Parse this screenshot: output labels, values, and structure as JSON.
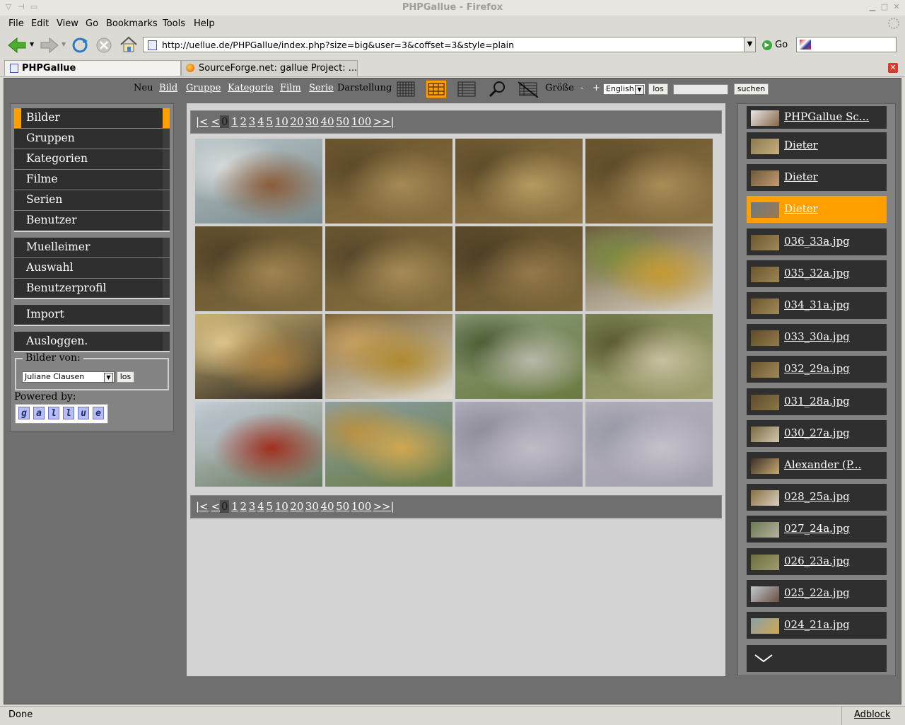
{
  "window": {
    "title": "PHPGallue - Firefox"
  },
  "menubar": [
    "File",
    "Edit",
    "View",
    "Go",
    "Bookmarks",
    "Tools",
    "Help"
  ],
  "address": {
    "url": "http://uellue.de/PHPGallue/index.php?size=big&user=3&coffset=3&style=plain",
    "go_label": "Go"
  },
  "tabs": [
    {
      "label": "PHPGallue",
      "active": true
    },
    {
      "label": "SourceForge.net: gallue Project: ...",
      "active": false
    }
  ],
  "topnav": {
    "neu": "Neu",
    "links": [
      "Bild",
      "Gruppe",
      "Kategorie",
      "Film",
      "Serie"
    ],
    "darstellung": "Darstellung",
    "groesse": "Größe",
    "minus": "-",
    "plus": "+",
    "language": "English",
    "los": "los",
    "search_button": "suchen",
    "active_view": "grid-big"
  },
  "leftmenu": {
    "group1": [
      "Bilder",
      "Gruppen",
      "Kategorien",
      "Filme",
      "Serien",
      "Benutzer"
    ],
    "group2": [
      "Muelleimer",
      "Auswahl",
      "Benutzerprofil"
    ],
    "group3": [
      "Import"
    ],
    "group4": [
      "Ausloggen."
    ],
    "active": "Bilder",
    "bilder_von": {
      "legend": "Bilder von:",
      "selected_user": "Juliane Clausen",
      "los": "los"
    },
    "powered_by": "Powered by:",
    "logo_letters": [
      "g",
      "a",
      "l",
      "l",
      "u",
      "e"
    ]
  },
  "pager": {
    "items": [
      "|<",
      "<",
      "0",
      "1",
      "2",
      "3",
      "4",
      "5",
      "10",
      "20",
      "30",
      "40",
      "50",
      "100",
      ">",
      ">|"
    ],
    "current": "0"
  },
  "thumbnails": [
    {
      "name": "man-at-lake-photo",
      "colors": [
        "#b7c3c6",
        "#7a8a8c",
        "#8a5c3a",
        "#d8dcdc"
      ]
    },
    {
      "name": "stream-bed-photo",
      "colors": [
        "#6a5530",
        "#8a7040",
        "#a58a55",
        "#5a4828"
      ]
    },
    {
      "name": "stream-bed-photo",
      "colors": [
        "#6d5832",
        "#917745",
        "#b59a60",
        "#5c4a29"
      ]
    },
    {
      "name": "stream-bed-photo",
      "colors": [
        "#6a5530",
        "#8c7342",
        "#a98d58",
        "#5b4928"
      ]
    },
    {
      "name": "stream-bed-photo",
      "colors": [
        "#63502e",
        "#7e6a3e",
        "#a08450",
        "#4f4126"
      ]
    },
    {
      "name": "stream-bed-photo",
      "colors": [
        "#6a5532",
        "#85703f",
        "#a68b55",
        "#56462a"
      ]
    },
    {
      "name": "stream-bed-photo",
      "colors": [
        "#5c4a2a",
        "#7c673a",
        "#94794a",
        "#4c3e24"
      ]
    },
    {
      "name": "elderly-woman-photo",
      "colors": [
        "#6a5a3a",
        "#d8d0c0",
        "#c49a30",
        "#7a8a40"
      ]
    },
    {
      "name": "young-man-photo",
      "colors": [
        "#c8b070",
        "#2a2420",
        "#a88040",
        "#e0c890"
      ]
    },
    {
      "name": "elderly-woman-photo",
      "colors": [
        "#7a6030",
        "#e0dcd0",
        "#b08a30",
        "#c8a060"
      ]
    },
    {
      "name": "forest-river-photo",
      "colors": [
        "#8a9a7a",
        "#6a7a40",
        "#b8b8a8",
        "#4a5a30"
      ]
    },
    {
      "name": "reeds-water-photo",
      "colors": [
        "#7a8050",
        "#a0a070",
        "#c8c0a0",
        "#585830"
      ]
    },
    {
      "name": "canoe-lake-photo",
      "colors": [
        "#c8d0d8",
        "#6a7a60",
        "#a03020",
        "#b0bcc4"
      ]
    },
    {
      "name": "marsh-landscape-photo",
      "colors": [
        "#8aa0a8",
        "#6a7a40",
        "#d0a850",
        "#b89040"
      ]
    },
    {
      "name": "birds-sky-photo",
      "colors": [
        "#b0aeba",
        "#9c9aa8",
        "#c0bcc6",
        "#8e8c98"
      ]
    },
    {
      "name": "birds-sky-photo",
      "colors": [
        "#b4b0bc",
        "#a2a0ac",
        "#c6c0ca",
        "#969aa6"
      ]
    }
  ],
  "rightlist": [
    {
      "label": "PHPGallue Sc...",
      "thumb": [
        "#e8e8e8",
        "#886644"
      ]
    },
    {
      "label": "Dieter",
      "thumb": [
        "#8a7a50",
        "#c8b080"
      ]
    },
    {
      "label": "Dieter",
      "thumb": [
        "#6a5a3a",
        "#c89a70"
      ]
    },
    {
      "label": "Dieter",
      "thumb": [
        "#6a7a80",
        "#a07850"
      ],
      "active": true
    },
    {
      "label": "036_33a.jpg",
      "thumb": [
        "#6a5530",
        "#a08a58"
      ]
    },
    {
      "label": "035_32a.jpg",
      "thumb": [
        "#6a5530",
        "#9c8652"
      ]
    },
    {
      "label": "034_31a.jpg",
      "thumb": [
        "#6a5530",
        "#a08a58"
      ]
    },
    {
      "label": "033_30a.jpg",
      "thumb": [
        "#5e4c2c",
        "#927a48"
      ]
    },
    {
      "label": "032_29a.jpg",
      "thumb": [
        "#6a5530",
        "#a08a58"
      ]
    },
    {
      "label": "031_28a.jpg",
      "thumb": [
        "#5e4c2c",
        "#8c7646"
      ]
    },
    {
      "label": "030_27a.jpg",
      "thumb": [
        "#7a6a40",
        "#d0c8b0"
      ]
    },
    {
      "label": "Alexander (P...",
      "thumb": [
        "#3a3028",
        "#c8a870"
      ]
    },
    {
      "label": "028_25a.jpg",
      "thumb": [
        "#8a7040",
        "#d8d0c0"
      ]
    },
    {
      "label": "027_24a.jpg",
      "thumb": [
        "#6a7a50",
        "#b8b0a0"
      ]
    },
    {
      "label": "026_23a.jpg",
      "thumb": [
        "#6a7040",
        "#a09a70"
      ]
    },
    {
      "label": "025_22a.jpg",
      "thumb": [
        "#c0c8d0",
        "#6a5040"
      ]
    },
    {
      "label": "024_21a.jpg",
      "thumb": [
        "#8aa0a8",
        "#d0a850"
      ]
    }
  ],
  "status": {
    "text": "Done",
    "addon": "Adblock"
  },
  "colors": {
    "accent": "#ff9f00",
    "panel_dark": "#2f2f2f",
    "content_bg": "#6f6f6f"
  }
}
